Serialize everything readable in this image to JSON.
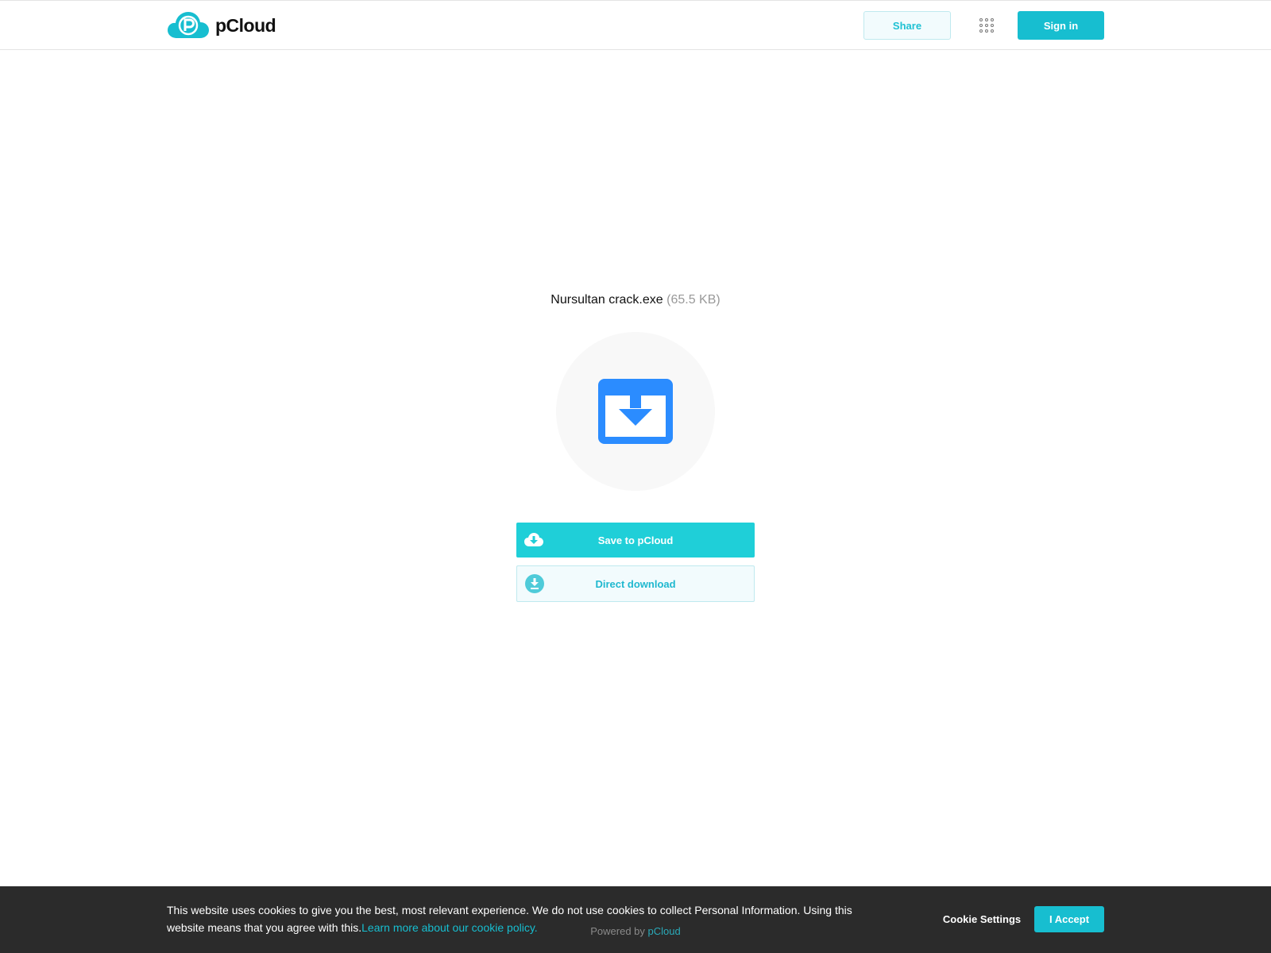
{
  "header": {
    "logo_text": "pCloud",
    "share_label": "Share",
    "apps_icon": "grid-icon",
    "signin_label": "Sign in"
  },
  "file": {
    "name": "Nursultan crack.exe",
    "size": "(65.5 KB)",
    "icon": "download-box-icon",
    "icon_color": "#2b8cff"
  },
  "actions": {
    "save_label": "Save to pCloud",
    "direct_label": "Direct download"
  },
  "footer": {
    "powered_prefix": "Powered by",
    "powered_link": "pCloud"
  },
  "cookie": {
    "text": "This website uses cookies to give you the best, most relevant experience. We do not use cookies to collect Personal Information. Using this website means that you agree with this.",
    "link": "Learn more about our cookie policy.",
    "settings_label": "Cookie Settings",
    "accept_label": "I Accept"
  },
  "colors": {
    "accent": "#17bed0",
    "save_bg": "#1fcfd8"
  }
}
